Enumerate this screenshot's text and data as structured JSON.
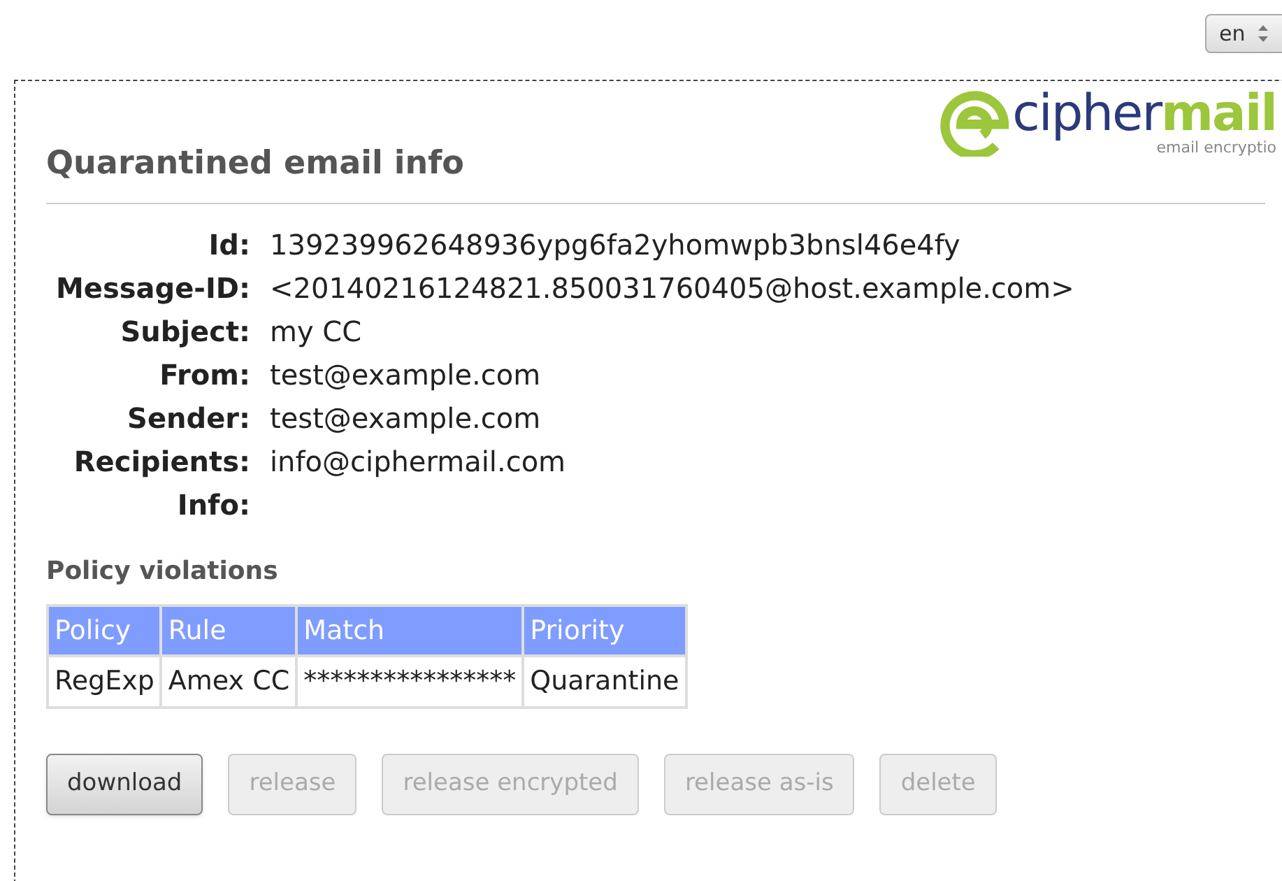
{
  "language_select": {
    "value": "en"
  },
  "logo": {
    "brand_first": "cipher",
    "brand_second": "mail",
    "tagline": "email encryptio"
  },
  "title": "Quarantined email info",
  "fields": [
    {
      "label": "Id:",
      "value": "139239962648936ypg6fa2yhomwpb3bnsl46e4fy"
    },
    {
      "label": "Message-ID:",
      "value": "<20140216124821.850031760405@host.example.com>"
    },
    {
      "label": "Subject:",
      "value": "my CC"
    },
    {
      "label": "From:",
      "value": "test@example.com"
    },
    {
      "label": "Sender:",
      "value": "test@example.com"
    },
    {
      "label": "Recipients:",
      "value": "info@ciphermail.com"
    },
    {
      "label": "Info:"
    }
  ],
  "policy_violations": {
    "heading": "Policy violations",
    "columns": [
      "Policy",
      "Rule",
      "Match",
      "Priority"
    ],
    "rows": [
      [
        "RegExp",
        "Amex CC",
        "****************",
        "Quarantine"
      ]
    ]
  },
  "buttons": [
    {
      "label": "download",
      "disabled": false
    },
    {
      "label": "release",
      "disabled": true
    },
    {
      "label": "release encrypted",
      "disabled": true
    },
    {
      "label": "release as-is",
      "disabled": true
    },
    {
      "label": "delete",
      "disabled": true
    }
  ]
}
